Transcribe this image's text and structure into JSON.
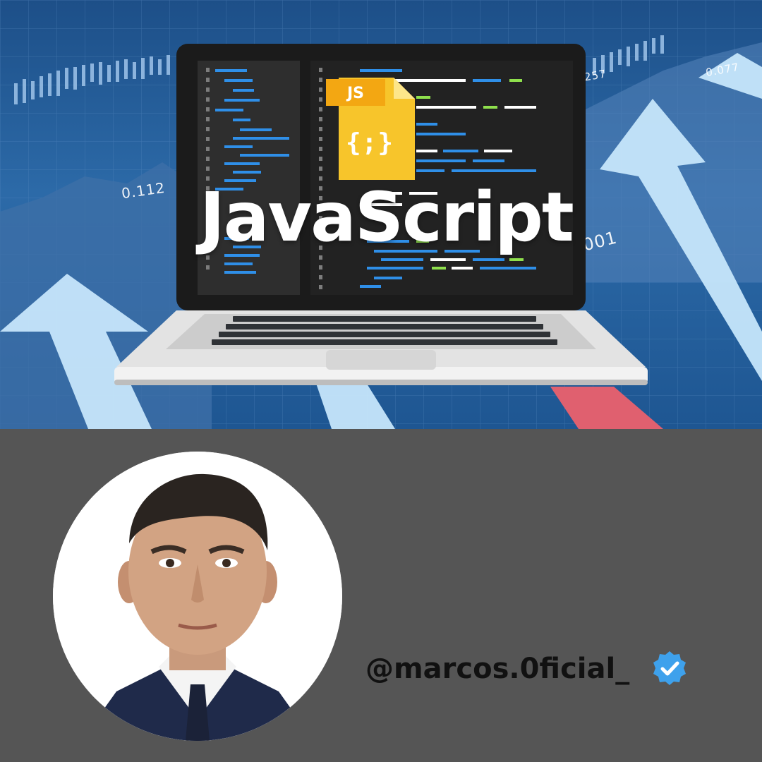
{
  "hero": {
    "title": "JavaScript",
    "file_icon": {
      "label": "JS",
      "glyph": "{;}"
    },
    "tick_labels": [
      "0.112",
      "257",
      "0.077",
      "001"
    ]
  },
  "profile": {
    "handle": "@marcos.0ficial_",
    "verified": true
  },
  "colors": {
    "background_lower": "#555555",
    "hero_blue": "#2c6aa8",
    "arrow_light": "#bfe3fb",
    "arrow_red": "#e0606f",
    "js_yellow": "#f7c52b",
    "code_blue": "#2f8fe8",
    "code_green": "#8fe04d",
    "verified_blue": "#3ea1ec"
  }
}
